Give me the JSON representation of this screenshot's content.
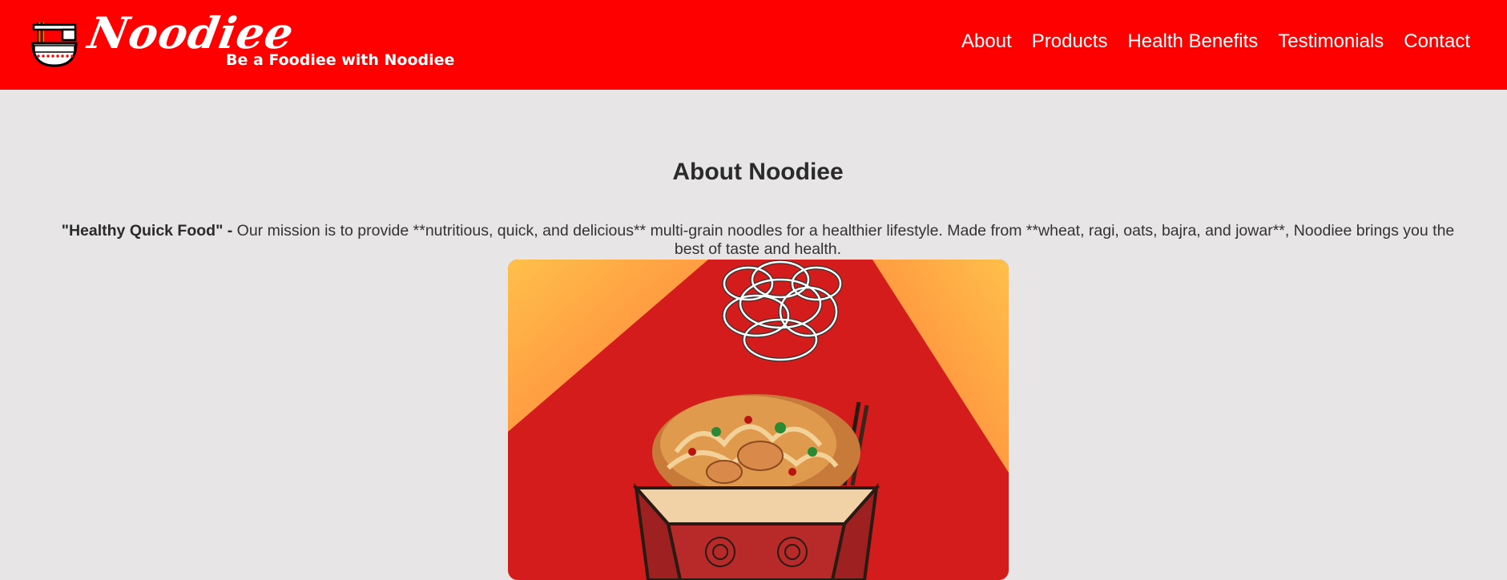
{
  "header": {
    "brand": "Noodiee",
    "tagline": "Be a Foodiee with Noodiee",
    "logo_icon": "noodle-bowl-icon",
    "background": "#ff0000"
  },
  "nav": {
    "items": [
      {
        "label": "About"
      },
      {
        "label": "Products"
      },
      {
        "label": "Health Benefits"
      },
      {
        "label": "Testimonials"
      },
      {
        "label": "Contact"
      }
    ]
  },
  "about": {
    "title": "About Noodiee",
    "lead": "\"Healthy Quick Food\" -",
    "body": " Our mission is to provide **nutritious, quick, and delicious** multi-grain noodles for a healthier lifestyle. Made from **wheat, ragi, oats, bajra, and jowar**, Noodiee brings you the best of taste and health.",
    "image": "noodle-bowl-illustration"
  },
  "colors": {
    "accent": "#ff0000",
    "page_bg": "#e7e5e6",
    "text": "#333333"
  }
}
